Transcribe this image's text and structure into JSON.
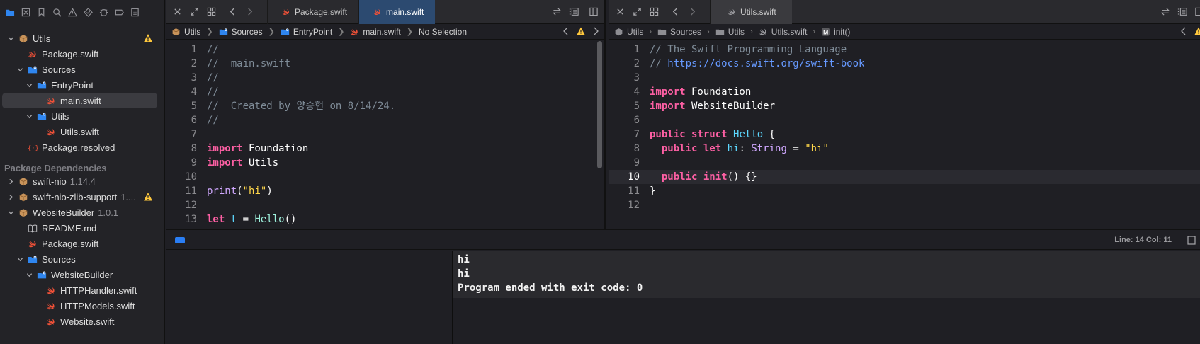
{
  "navigator": {
    "toolbar_icons": [
      "folder-icon",
      "source-control-icon",
      "bookmark-icon",
      "find-icon",
      "issue-icon",
      "test-icon",
      "debug-icon",
      "breakpoint-icon",
      "report-icon"
    ],
    "tree": [
      {
        "label": "Utils",
        "depth": 0,
        "expanded": true,
        "icon": "package-icon",
        "warning": true
      },
      {
        "label": "Package.swift",
        "depth": 1,
        "icon": "swift-file-icon"
      },
      {
        "label": "Sources",
        "depth": 1,
        "expanded": true,
        "icon": "folder-icon"
      },
      {
        "label": "EntryPoint",
        "depth": 2,
        "expanded": true,
        "icon": "folder-icon"
      },
      {
        "label": "main.swift",
        "depth": 3,
        "icon": "swift-file-icon",
        "selected": true
      },
      {
        "label": "Utils",
        "depth": 2,
        "expanded": true,
        "icon": "folder-icon"
      },
      {
        "label": "Utils.swift",
        "depth": 3,
        "icon": "swift-file-icon"
      },
      {
        "label": "Package.resolved",
        "depth": 1,
        "icon": "resolved-icon"
      }
    ],
    "dependencies_header": "Package Dependencies",
    "dependencies": [
      {
        "label": "swift-nio",
        "version": "1.14.4",
        "depth": 0,
        "expanded": false,
        "icon": "package-icon"
      },
      {
        "label": "swift-nio-zlib-support",
        "version": "1....",
        "depth": 0,
        "expanded": false,
        "icon": "package-icon",
        "warning": true
      },
      {
        "label": "WebsiteBuilder",
        "version": "1.0.1",
        "depth": 0,
        "expanded": true,
        "icon": "package-icon"
      },
      {
        "label": "README.md",
        "depth": 1,
        "icon": "book-icon"
      },
      {
        "label": "Package.swift",
        "depth": 1,
        "icon": "swift-file-icon"
      },
      {
        "label": "Sources",
        "depth": 1,
        "expanded": true,
        "icon": "folder-icon"
      },
      {
        "label": "WebsiteBuilder",
        "depth": 2,
        "expanded": true,
        "icon": "folder-icon"
      },
      {
        "label": "HTTPHandler.swift",
        "depth": 3,
        "icon": "swift-file-icon"
      },
      {
        "label": "HTTPModels.swift",
        "depth": 3,
        "icon": "swift-file-icon"
      },
      {
        "label": "Website.swift",
        "depth": 3,
        "icon": "swift-file-icon"
      }
    ]
  },
  "editor_left": {
    "tabs": [
      {
        "label": "Package.swift",
        "active": false
      },
      {
        "label": "main.swift",
        "active": true
      }
    ],
    "breadcrumbs": [
      "Utils",
      "Sources",
      "EntryPoint",
      "main.swift",
      "No Selection"
    ],
    "lines": [
      {
        "n": "1",
        "tokens": [
          {
            "t": "//",
            "c": "c-com"
          }
        ]
      },
      {
        "n": "2",
        "tokens": [
          {
            "t": "//  main.swift",
            "c": "c-com"
          }
        ]
      },
      {
        "n": "3",
        "tokens": [
          {
            "t": "//",
            "c": "c-com"
          }
        ]
      },
      {
        "n": "4",
        "tokens": [
          {
            "t": "//",
            "c": "c-com"
          }
        ]
      },
      {
        "n": "5",
        "tokens": [
          {
            "t": "//  Created by 양승현 on 8/14/24.",
            "c": "c-com"
          }
        ]
      },
      {
        "n": "6",
        "tokens": [
          {
            "t": "//",
            "c": "c-com"
          }
        ]
      },
      {
        "n": "7",
        "tokens": []
      },
      {
        "n": "8",
        "tokens": [
          {
            "t": "import",
            "c": "c-kw"
          },
          {
            "t": " Foundation",
            "c": "c-plain"
          }
        ]
      },
      {
        "n": "9",
        "tokens": [
          {
            "t": "import",
            "c": "c-kw"
          },
          {
            "t": " Utils",
            "c": "c-plain"
          }
        ]
      },
      {
        "n": "10",
        "tokens": []
      },
      {
        "n": "11",
        "tokens": [
          {
            "t": "print",
            "c": "c-type"
          },
          {
            "t": "(",
            "c": "c-plain"
          },
          {
            "t": "\"hi\"",
            "c": "c-str2"
          },
          {
            "t": ")",
            "c": "c-plain"
          }
        ]
      },
      {
        "n": "12",
        "tokens": []
      },
      {
        "n": "13",
        "tokens": [
          {
            "t": "let",
            "c": "c-kw"
          },
          {
            "t": " ",
            "c": "c-plain"
          },
          {
            "t": "t",
            "c": "c-name"
          },
          {
            "t": " = ",
            "c": "c-plain"
          },
          {
            "t": "Hello",
            "c": "c-ty2"
          },
          {
            "t": "()",
            "c": "c-plain"
          }
        ]
      }
    ]
  },
  "editor_right": {
    "tabs": [
      {
        "label": "Utils.swift",
        "active": false
      }
    ],
    "breadcrumbs": [
      "Utils",
      "Sources",
      "Utils",
      "Utils.swift",
      "init()"
    ],
    "current_line": "10",
    "lines": [
      {
        "n": "1",
        "tokens": [
          {
            "t": "// The Swift Programming Language",
            "c": "c-com"
          }
        ]
      },
      {
        "n": "2",
        "tokens": [
          {
            "t": "// ",
            "c": "c-com"
          },
          {
            "t": "https://docs.swift.org/swift-book",
            "c": "c-link"
          }
        ]
      },
      {
        "n": "3",
        "tokens": []
      },
      {
        "n": "4",
        "tokens": [
          {
            "t": "import",
            "c": "c-kw"
          },
          {
            "t": " Foundation",
            "c": "c-plain"
          }
        ]
      },
      {
        "n": "5",
        "tokens": [
          {
            "t": "import",
            "c": "c-kw"
          },
          {
            "t": " WebsiteBuilder",
            "c": "c-plain"
          }
        ]
      },
      {
        "n": "6",
        "tokens": []
      },
      {
        "n": "7",
        "tokens": [
          {
            "t": "public",
            "c": "c-kw"
          },
          {
            "t": " ",
            "c": "c-plain"
          },
          {
            "t": "struct",
            "c": "c-kw"
          },
          {
            "t": " ",
            "c": "c-plain"
          },
          {
            "t": "Hello",
            "c": "c-name"
          },
          {
            "t": " {",
            "c": "c-plain"
          }
        ]
      },
      {
        "n": "8",
        "tokens": [
          {
            "t": "  ",
            "c": "c-plain"
          },
          {
            "t": "public",
            "c": "c-kw"
          },
          {
            "t": " ",
            "c": "c-plain"
          },
          {
            "t": "let",
            "c": "c-kw"
          },
          {
            "t": " ",
            "c": "c-plain"
          },
          {
            "t": "hi",
            "c": "c-name"
          },
          {
            "t": ": ",
            "c": "c-plain"
          },
          {
            "t": "String",
            "c": "c-type"
          },
          {
            "t": " = ",
            "c": "c-plain"
          },
          {
            "t": "\"hi\"",
            "c": "c-str2"
          }
        ]
      },
      {
        "n": "9",
        "tokens": []
      },
      {
        "n": "10",
        "tokens": [
          {
            "t": "  ",
            "c": "c-plain"
          },
          {
            "t": "public",
            "c": "c-kw"
          },
          {
            "t": " ",
            "c": "c-plain"
          },
          {
            "t": "init",
            "c": "c-kw"
          },
          {
            "t": "() {}",
            "c": "c-plain"
          }
        ]
      },
      {
        "n": "11",
        "tokens": [
          {
            "t": "}",
            "c": "c-plain"
          }
        ]
      },
      {
        "n": "12",
        "tokens": []
      }
    ]
  },
  "debug": {
    "cursor_position": "Line: 14  Col: 11",
    "console_lines": [
      "hi",
      "hi",
      "Program ended with exit code: 0"
    ]
  },
  "colors": {
    "accent": "#2a7ef5",
    "active_tab": "#2c4a70",
    "keyword": "#fc5fa3",
    "string": "#ffd74a",
    "comment": "#7f8c98",
    "warning": "#ffc83d",
    "folder": "#2f86f0",
    "swift": "#f05138"
  }
}
